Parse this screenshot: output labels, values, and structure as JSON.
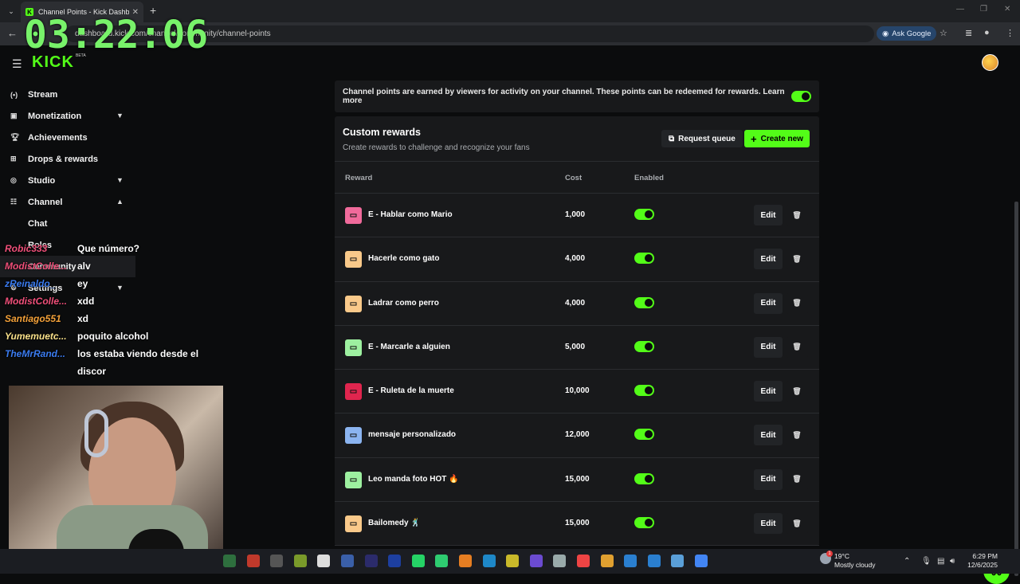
{
  "browser": {
    "tab_title": "Channel Points - Kick Dashboard",
    "url": "dashboard.kick.com/channel/community/channel-points",
    "ask_google": "Ask Google"
  },
  "overlay": {
    "clock": "03:22:06"
  },
  "logo": {
    "text": "KICK",
    "beta": "BETA"
  },
  "sidebar": {
    "items": [
      {
        "label": "Stream",
        "icon": "broadcast-icon"
      },
      {
        "label": "Monetization",
        "icon": "money-icon",
        "expand": "down"
      },
      {
        "label": "Achievements",
        "icon": "trophy-icon"
      },
      {
        "label": "Drops & rewards",
        "icon": "gift-icon"
      },
      {
        "label": "Studio",
        "icon": "studio-icon",
        "expand": "down"
      },
      {
        "label": "Channel",
        "icon": "channel-icon",
        "expand": "up"
      }
    ],
    "sub_items": [
      {
        "label": "Chat"
      },
      {
        "label": "Roles"
      },
      {
        "label": "Community"
      }
    ],
    "settings": {
      "label": "Settings"
    }
  },
  "chat": [
    {
      "user": "Robic333",
      "color": "#f0507a",
      "msg": "Que número?"
    },
    {
      "user": "ModistColle...",
      "color": "#f0507a",
      "msg": "alv"
    },
    {
      "user": "zReinaldo_",
      "color": "#3b7cf0",
      "msg": "ey"
    },
    {
      "user": "ModistColle...",
      "color": "#f0507a",
      "msg": "xdd"
    },
    {
      "user": "Santiago551",
      "color": "#f4a23a",
      "msg": "xd"
    },
    {
      "user": "Yumemuetc...",
      "color": "#f8e08a",
      "msg": "poquito alcohol"
    },
    {
      "user": "TheMrRand...",
      "color": "#3b7cf0",
      "msg": "los estaba viendo desde el"
    },
    {
      "user": "",
      "color": "#ffffff",
      "msg": "discor"
    }
  ],
  "main": {
    "info_text": "Channel points are earned by viewers for activity on your channel. These points can be redeemed for rewards. Learn more",
    "info_enabled": true,
    "panel_title": "Custom rewards",
    "panel_desc": "Create rewards to challenge and recognize your fans",
    "request_queue": "Request queue",
    "create_new": "Create new",
    "columns": {
      "reward": "Reward",
      "cost": "Cost",
      "enabled": "Enabled"
    },
    "edit_label": "Edit",
    "rewards": [
      {
        "name": "E - Hablar como Mario",
        "cost": "1,000",
        "enabled": true,
        "color": "#f06a9b"
      },
      {
        "name": "Hacerle como gato",
        "cost": "4,000",
        "enabled": true,
        "color": "#f9c98a"
      },
      {
        "name": "Ladrar como perro",
        "cost": "4,000",
        "enabled": true,
        "color": "#f9c98a"
      },
      {
        "name": "E - Marcarle a alguien",
        "cost": "5,000",
        "enabled": true,
        "color": "#9df0a0"
      },
      {
        "name": "E - Ruleta de la muerte",
        "cost": "10,000",
        "enabled": true,
        "color": "#e0254e"
      },
      {
        "name": "mensaje personalizado",
        "cost": "12,000",
        "enabled": true,
        "color": "#8bb4f0"
      },
      {
        "name": "Leo manda foto HOT 🔥",
        "cost": "15,000",
        "enabled": true,
        "color": "#9df0a0"
      },
      {
        "name": "Bailomedy 🕺",
        "cost": "15,000",
        "enabled": true,
        "color": "#f9c98a"
      }
    ]
  },
  "taskbar": {
    "weather_temp": "19°C",
    "weather_desc": "Mostly cloudy",
    "weather_badge": "1",
    "time": "6:29 PM",
    "date": "12/6/2025"
  }
}
